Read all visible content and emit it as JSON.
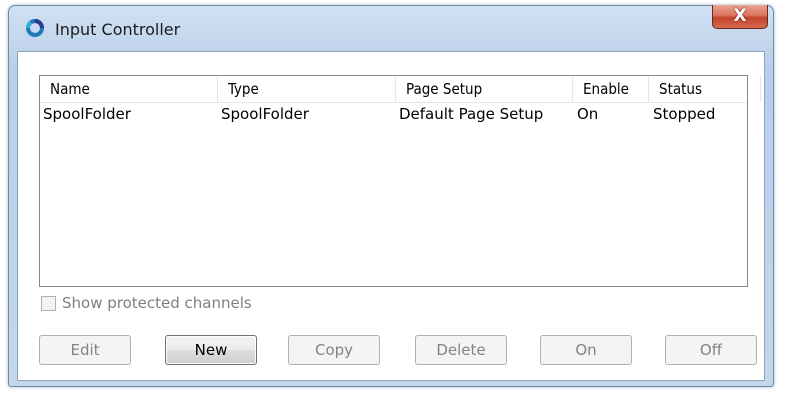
{
  "window": {
    "title": "Input Controller",
    "close_label": "X"
  },
  "table": {
    "columns": [
      "Name",
      "Type",
      "Page Setup",
      "Enable",
      "Status"
    ],
    "rows": [
      [
        "SpoolFolder",
        "SpoolFolder",
        "Default Page Setup",
        "On",
        "Stopped"
      ]
    ]
  },
  "options": {
    "show_protected_label": "Show protected channels",
    "show_protected_checked": false
  },
  "buttons": {
    "edit": "Edit",
    "new": "New",
    "copy": "Copy",
    "delete": "Delete",
    "on": "On",
    "off": "Off"
  },
  "colors": {
    "title_bar": "#c5d8ee",
    "close_button": "#c5432a",
    "disabled_text": "#838383"
  }
}
